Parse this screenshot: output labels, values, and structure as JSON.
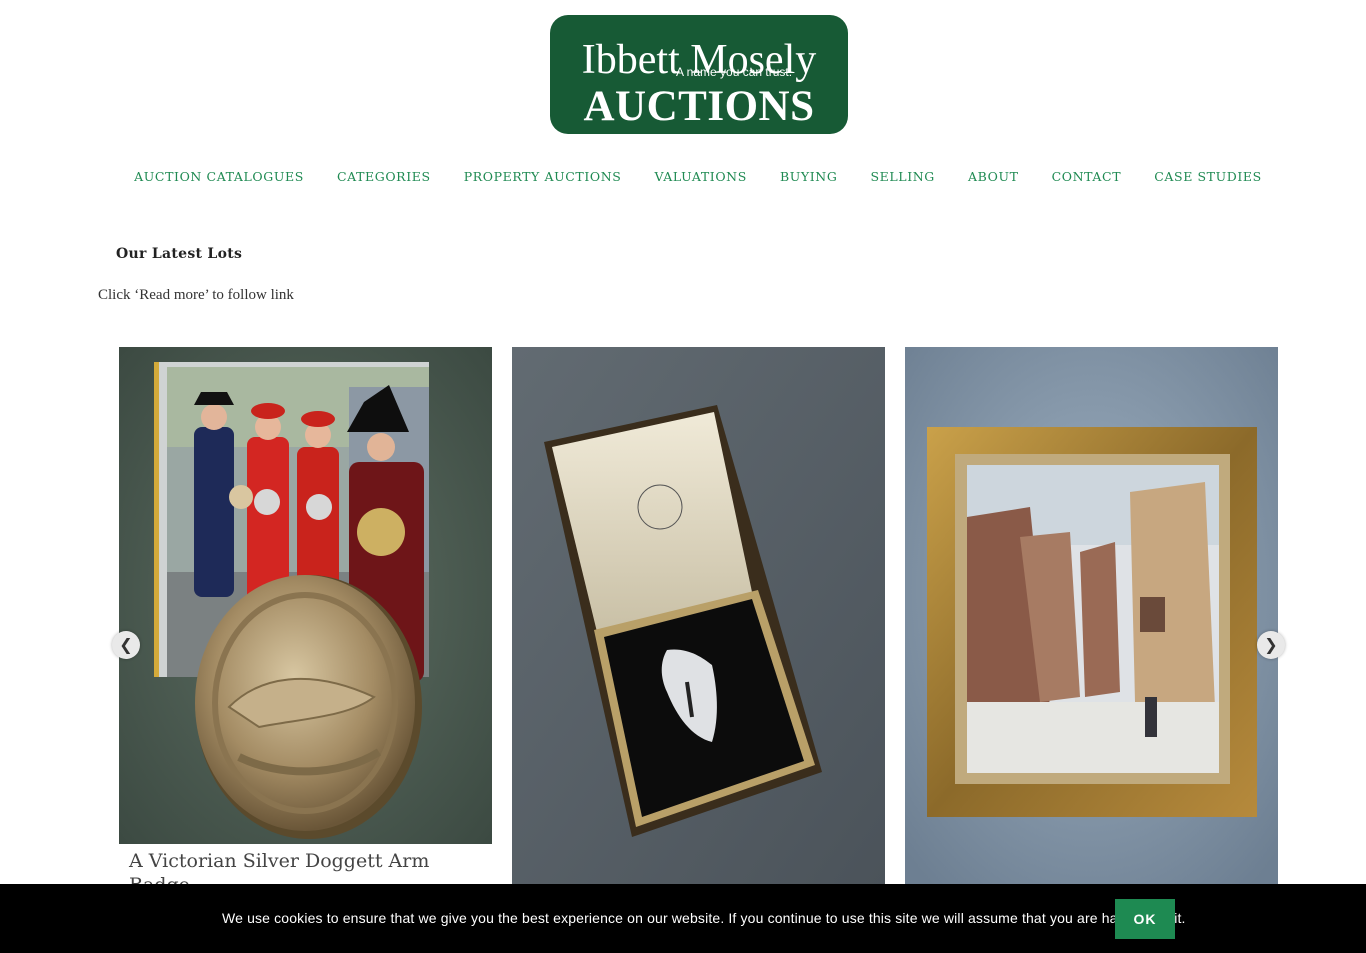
{
  "logo": {
    "line1": "Ibbett Mosely",
    "tagline": "A name you can trust.",
    "line2": "AUCTIONS",
    "bg": "#175a35"
  },
  "nav": {
    "items": [
      {
        "label": "AUCTION CATALOGUES"
      },
      {
        "label": "CATEGORIES"
      },
      {
        "label": "PROPERTY AUCTIONS"
      },
      {
        "label": "VALUATIONS"
      },
      {
        "label": "BUYING"
      },
      {
        "label": "SELLING"
      },
      {
        "label": "ABOUT"
      },
      {
        "label": "CONTACT"
      },
      {
        "label": "CASE STUDIES"
      }
    ],
    "color": "#1f8a52"
  },
  "section": {
    "heading": "Our Latest Lots",
    "subtitle": "Click ‘Read more’ to follow link"
  },
  "lots": [
    {
      "title": "A Victorian Silver Doggett Arm Badge",
      "image": "badge-photo"
    },
    {
      "title": "",
      "image": "brooch-photo"
    },
    {
      "title": "",
      "image": "painting-photo"
    }
  ],
  "carousel": {
    "prev_icon": "chevron-left-icon",
    "next_icon": "chevron-right-icon"
  },
  "cookie": {
    "text": "We use cookies to ensure that we give you the best experience on our website. If you continue to use this site we will assume that you are happy with it.",
    "ok_label": "OK",
    "accent": "#1e8a52"
  }
}
